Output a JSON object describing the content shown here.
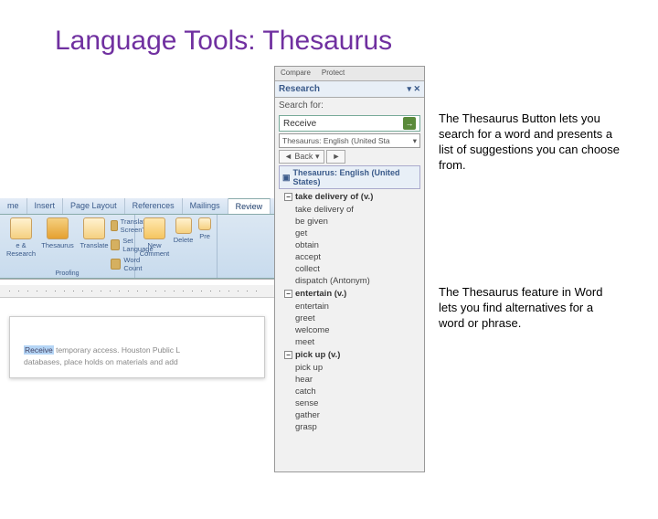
{
  "slide": {
    "title": "Language Tools: Thesaurus"
  },
  "paragraphs": {
    "p1": "    The Thesaurus Button lets you search for a word and presents a list of suggestions you can choose from.",
    "p2": "    The Thesaurus feature in Word lets you find alternatives for a word or phrase."
  },
  "research": {
    "top_tabs": [
      "Compare",
      "Protect"
    ],
    "title": "Research",
    "search_for_label": "Search for:",
    "search_value": "Receive",
    "source": "Thesaurus: English (United Sta",
    "back_label": "Back",
    "group_title": "Thesaurus: English (United States)",
    "entries": [
      {
        "head": "take delivery of (v.)",
        "items": [
          "take delivery of",
          "be given",
          "get",
          "obtain",
          "accept",
          "collect",
          "dispatch (Antonym)"
        ]
      },
      {
        "head": "entertain (v.)",
        "items": [
          "entertain",
          "greet",
          "welcome",
          "meet"
        ]
      },
      {
        "head": "pick up (v.)",
        "items": [
          "pick up",
          "hear",
          "catch",
          "sense",
          "gather",
          "grasp"
        ]
      }
    ]
  },
  "word": {
    "tabs": [
      "me",
      "Insert",
      "Page Layout",
      "References",
      "Mailings",
      "Review"
    ],
    "active_tab": "Review",
    "buttons": {
      "research": "e & Research",
      "thesaurus": "Thesaurus",
      "translate": "Translate",
      "new_comment": "New Comment",
      "delete": "Delete",
      "prev": "Pre"
    },
    "small": {
      "trans_tip": "Translation ScreenTip",
      "set_lang": "Set Language",
      "word_count": "Word Count"
    },
    "group_label": "Proofing",
    "doc": {
      "line1_hl": "Receive",
      "line1_rest": " temporary access. Houston Public L",
      "line2": "databases, place holds on materials and add"
    }
  }
}
